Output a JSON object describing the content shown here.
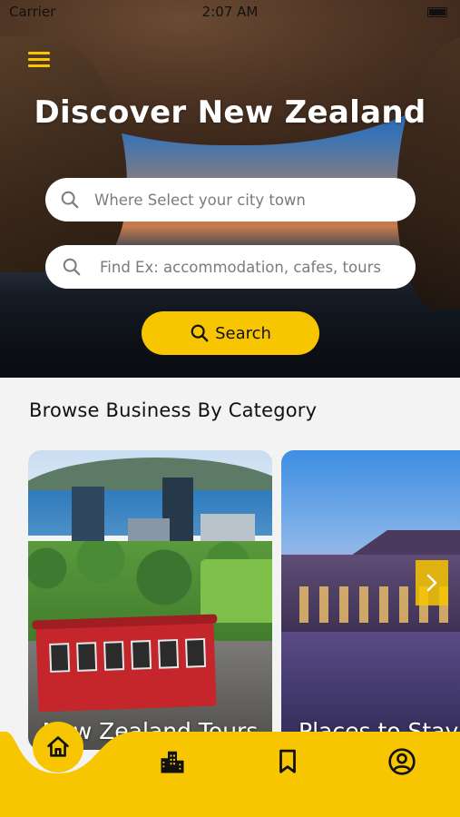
{
  "status_bar": {
    "carrier": "Carrier",
    "time": "2:07 AM"
  },
  "hero": {
    "title": "Discover New Zealand",
    "city_field": {
      "placeholder": "Where Select your city town"
    },
    "find_field": {
      "placeholder": "Find Ex: accommodation, cafes, tours"
    },
    "search_button": {
      "label": "Search"
    }
  },
  "section": {
    "title": "Browse Business By Category"
  },
  "categories": [
    {
      "label": "New Zealand Tours"
    },
    {
      "label": "Places to Stay"
    }
  ],
  "colors": {
    "accent": "#f7c600"
  },
  "nav": {
    "items": [
      {
        "icon": "home-icon",
        "active": true
      },
      {
        "icon": "city-icon",
        "active": false
      },
      {
        "icon": "bookmark-icon",
        "active": false
      },
      {
        "icon": "profile-icon",
        "active": false
      }
    ]
  }
}
